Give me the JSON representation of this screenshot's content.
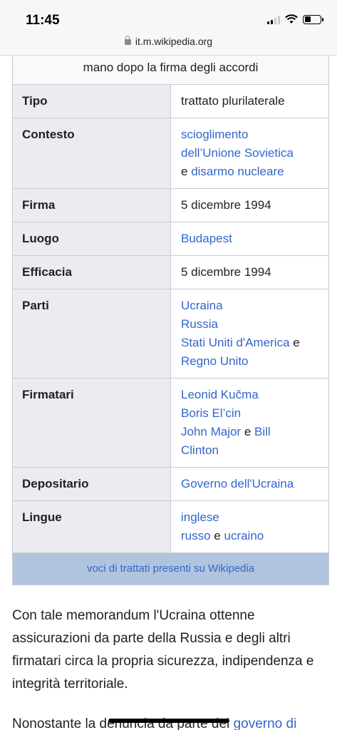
{
  "status": {
    "time": "11:45",
    "url": "it.m.wikipedia.org"
  },
  "infobox": {
    "caption": "mano dopo la firma degli accordi",
    "rows": [
      {
        "label": "Tipo",
        "parts": [
          [
            {
              "t": "trattato plurilaterale",
              "l": false
            }
          ]
        ]
      },
      {
        "label": "Contesto",
        "parts": [
          [
            {
              "t": "scioglimento",
              "l": true
            }
          ],
          [
            {
              "t": "dell’Unione Sovietica",
              "l": true
            }
          ],
          [
            {
              "t": "e ",
              "l": false
            },
            {
              "t": "disarmo nucleare",
              "l": true
            }
          ]
        ]
      },
      {
        "label": "Firma",
        "parts": [
          [
            {
              "t": "5 dicembre 1994",
              "l": false
            }
          ]
        ]
      },
      {
        "label": "Luogo",
        "parts": [
          [
            {
              "t": "Budapest",
              "l": true
            }
          ]
        ]
      },
      {
        "label": "Efficacia",
        "parts": [
          [
            {
              "t": "5 dicembre 1994",
              "l": false
            }
          ]
        ]
      },
      {
        "label": "Parti",
        "parts": [
          [
            {
              "t": "Ucraina",
              "l": true
            }
          ],
          [
            {
              "t": "Russia",
              "l": true
            }
          ],
          [
            {
              "t": "Stati Uniti d'America",
              "l": true
            },
            {
              "t": " e",
              "l": false
            }
          ],
          [
            {
              "t": "Regno Unito",
              "l": true
            }
          ]
        ]
      },
      {
        "label": "Firmatari",
        "parts": [
          [
            {
              "t": "Leonid Kučma",
              "l": true
            }
          ],
          [
            {
              "t": "Boris El’cin",
              "l": true
            }
          ],
          [
            {
              "t": "John Major",
              "l": true
            },
            {
              "t": " e ",
              "l": false
            },
            {
              "t": "Bill",
              "l": true
            }
          ],
          [
            {
              "t": "Clinton",
              "l": true
            }
          ]
        ]
      },
      {
        "label": "Depositario",
        "parts": [
          [
            {
              "t": "Governo dell'Ucraina",
              "l": true
            }
          ]
        ]
      },
      {
        "label": "Lingue",
        "parts": [
          [
            {
              "t": "inglese",
              "l": true
            }
          ],
          [
            {
              "t": "russo",
              "l": true
            },
            {
              "t": " e ",
              "l": false
            },
            {
              "t": "ucraino",
              "l": true
            }
          ]
        ]
      }
    ],
    "footer": "voci di trattati presenti su Wikipedia"
  },
  "body": {
    "p1": "Con tale memorandum l'Ucraina ottenne assicurazioni da parte della Russia e degli altri firmatari circa la propria sicurezza, indipendenza e integrità territoriale.",
    "p2_text": "Nonostante la denuncia da parte del ",
    "p2_link": "governo di"
  }
}
